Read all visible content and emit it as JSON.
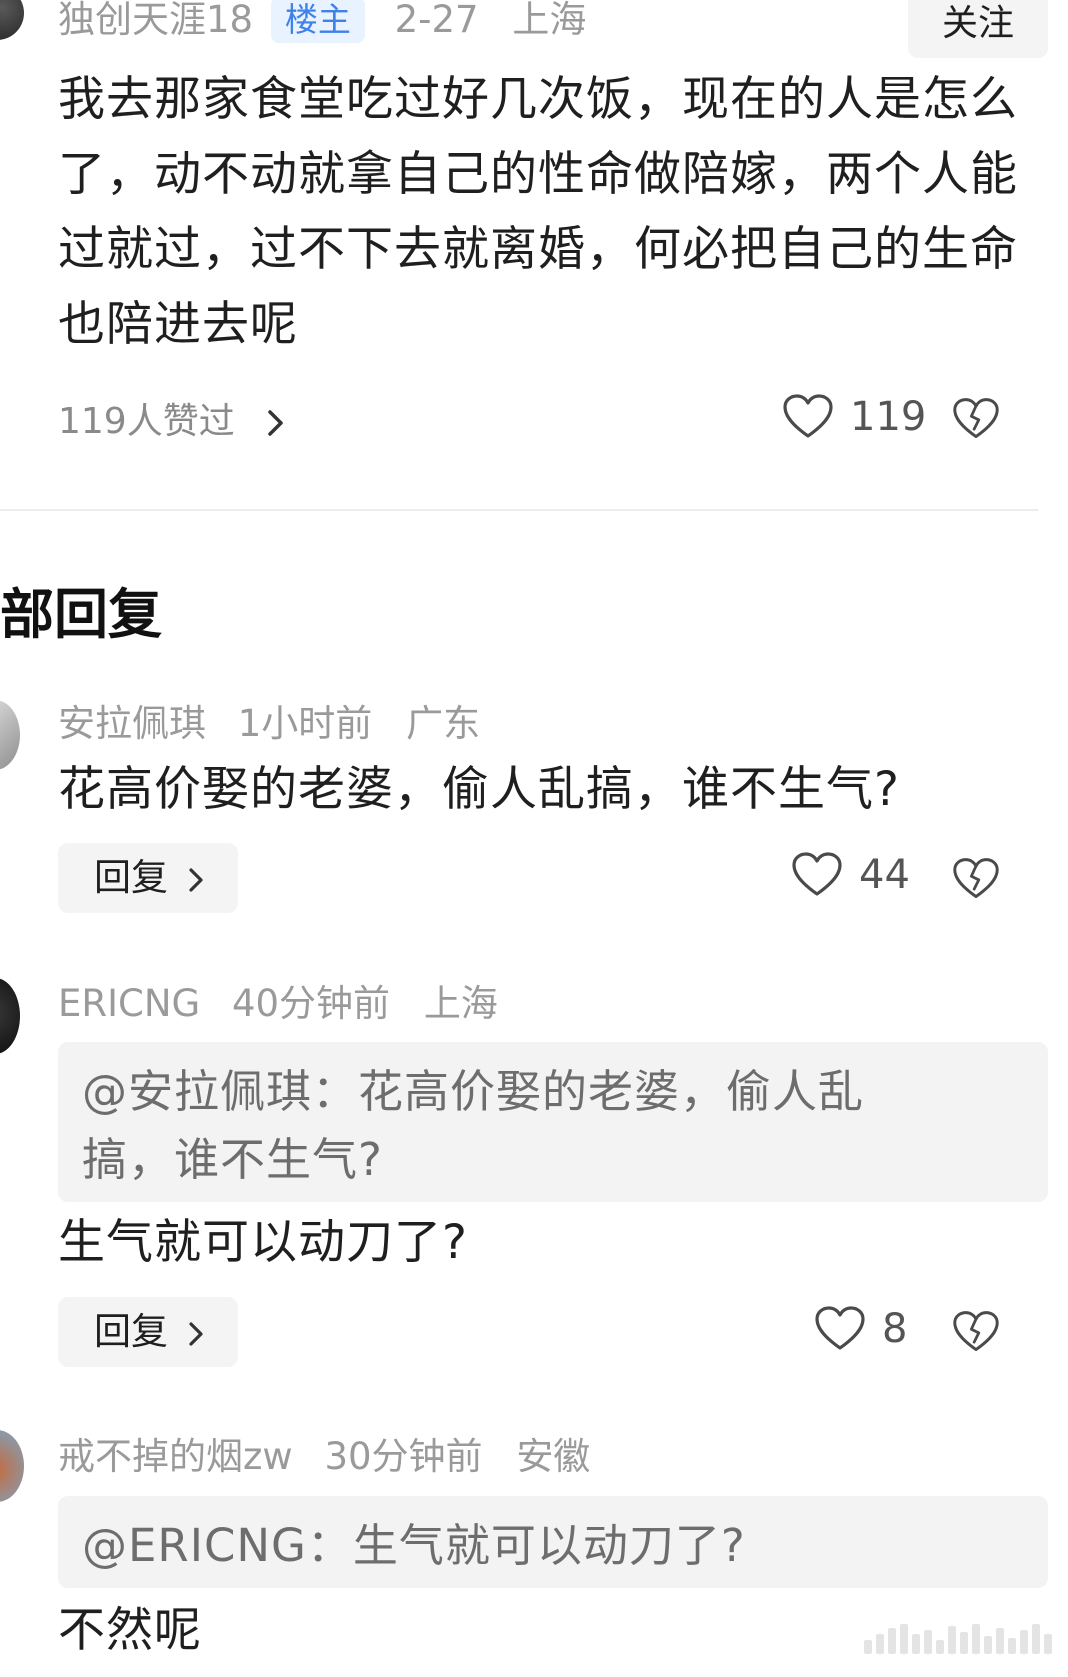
{
  "thread": {
    "author": "独创天涯18",
    "badge": "楼主",
    "date": "2-27",
    "location": "上海",
    "follow_label": "关注",
    "text": "我去那家食堂吃过好几次饭，现在的人是怎么了，动不动就拿自己的性命做陪嫁，两个人能过就过，过不下去就离婚，何必把自己的生命也陪进去呢",
    "likes_summary": "119人赞过",
    "like_count": "119"
  },
  "section_title": "部回复",
  "replies": [
    {
      "author": "安拉佩琪",
      "time": "1小时前",
      "location": "广东",
      "text": "花高价娶的老婆，偷人乱搞，谁不生气?",
      "reply_label": "回复",
      "like_count": "44"
    },
    {
      "author": "ERICNG",
      "time": "40分钟前",
      "location": "上海",
      "quote": "@安拉佩琪：花高价娶的老婆，偷人乱搞，谁不生气?",
      "text": "生气就可以动刀了?",
      "reply_label": "回复",
      "like_count": "8"
    },
    {
      "author": "戒不掉的烟zw",
      "time": "30分钟前",
      "location": "安徽",
      "quote": "@ERICNG：生气就可以动刀了?",
      "text": "不然呢"
    }
  ],
  "colors": {
    "badge_text": "#3e82e8",
    "badge_bg": "#e9f2ff",
    "meta_text": "#9a9a9a",
    "quote_bg": "#f3f3f3"
  },
  "icons": [
    "heart-outline-icon",
    "broken-heart-icon",
    "chevron-right-icon"
  ]
}
